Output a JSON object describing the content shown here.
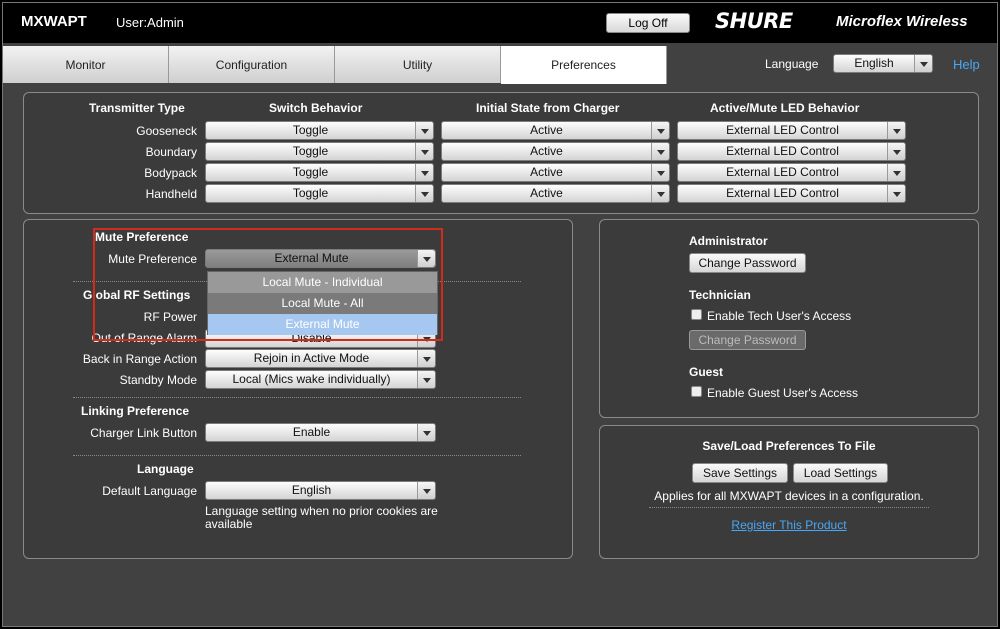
{
  "header": {
    "brand": "MXWAPT",
    "user": "User:Admin",
    "logoff": "Log Off",
    "shure": "SHURE",
    "product": "Microflex Wireless"
  },
  "tabs": [
    "Monitor",
    "Configuration",
    "Utility",
    "Preferences"
  ],
  "active_tab": "Preferences",
  "language_top": {
    "label": "Language",
    "value": "English"
  },
  "help": "Help",
  "transmitter": {
    "headers": [
      "Transmitter Type",
      "Switch Behavior",
      "Initial State from Charger",
      "Active/Mute LED Behavior"
    ],
    "rows": [
      {
        "type": "Gooseneck",
        "switch": "Toggle",
        "initial": "Active",
        "led": "External LED Control"
      },
      {
        "type": "Boundary",
        "switch": "Toggle",
        "initial": "Active",
        "led": "External LED Control"
      },
      {
        "type": "Bodypack",
        "switch": "Toggle",
        "initial": "Active",
        "led": "External LED Control"
      },
      {
        "type": "Handheld",
        "switch": "Toggle",
        "initial": "Active",
        "led": "External LED Control"
      }
    ]
  },
  "mute": {
    "section": "Mute Preference",
    "label": "Mute Preference",
    "value": "External Mute",
    "options": [
      "Local Mute - Individual",
      "Local Mute - All",
      "External Mute"
    ]
  },
  "rf": {
    "section": "Global RF Settings",
    "rf_power_label": "RF Power",
    "out_of_range_label": "Out of Range Alarm",
    "out_of_range_value": "Disable",
    "back_in_range_label": "Back in Range Action",
    "back_in_range_value": "Rejoin in Active Mode",
    "standby_label": "Standby Mode",
    "standby_value": "Local (Mics wake individually)"
  },
  "linking": {
    "section": "Linking Preference",
    "label": "Charger Link Button",
    "value": "Enable"
  },
  "language": {
    "section": "Language",
    "label": "Default Language",
    "value": "English",
    "note": "Language setting when no prior cookies are available"
  },
  "admin": {
    "administrator": "Administrator",
    "change_password": "Change Password",
    "technician": "Technician",
    "enable_tech": "Enable Tech User's Access",
    "tech_change_password": "Change Password",
    "guest": "Guest",
    "enable_guest": "Enable Guest User's Access"
  },
  "saveload": {
    "title": "Save/Load Preferences To File",
    "save": "Save Settings",
    "load": "Load Settings",
    "note": "Applies for all MXWAPT devices in a configuration.",
    "register": "Register This Product"
  }
}
